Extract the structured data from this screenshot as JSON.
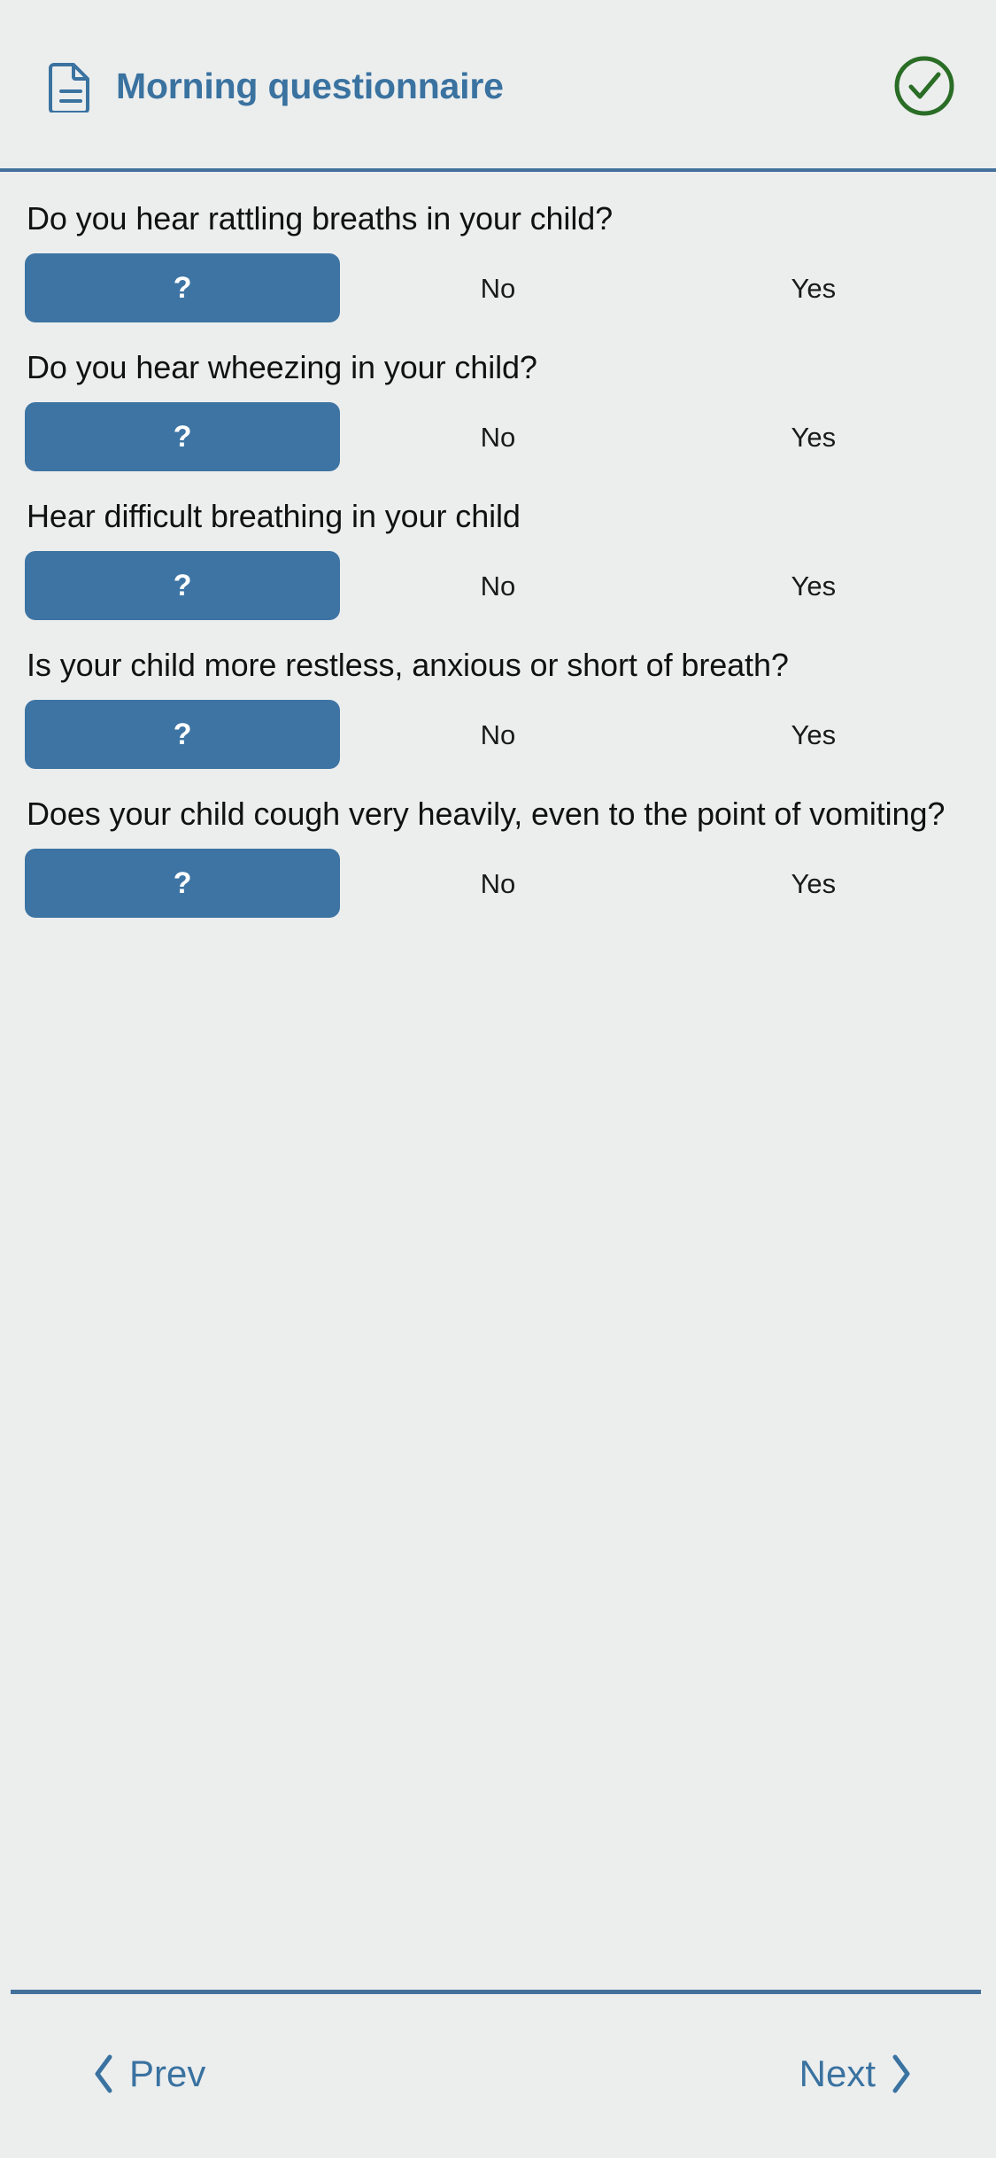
{
  "header": {
    "doc_icon": "document-icon",
    "title": "Morning questionnaire",
    "status_icon": "check-circle-icon",
    "accent_color": "#3a72a0",
    "status_color": "#2a6d26"
  },
  "questions": [
    {
      "text": "Do you hear rattling breaths in your child?",
      "options": [
        {
          "label": "?",
          "selected": true
        },
        {
          "label": "No",
          "selected": false
        },
        {
          "label": "Yes",
          "selected": false
        }
      ]
    },
    {
      "text": "Do you hear wheezing in your child?",
      "options": [
        {
          "label": "?",
          "selected": true
        },
        {
          "label": "No",
          "selected": false
        },
        {
          "label": "Yes",
          "selected": false
        }
      ]
    },
    {
      "text": "Hear difficult breathing in your child",
      "options": [
        {
          "label": "?",
          "selected": true
        },
        {
          "label": "No",
          "selected": false
        },
        {
          "label": "Yes",
          "selected": false
        }
      ]
    },
    {
      "text": "Is your child more restless, anxious or short of breath?",
      "options": [
        {
          "label": "?",
          "selected": true
        },
        {
          "label": "No",
          "selected": false
        },
        {
          "label": "Yes",
          "selected": false
        }
      ]
    },
    {
      "text": "Does your child cough very heavily, even to the point of vomiting?",
      "options": [
        {
          "label": "?",
          "selected": true
        },
        {
          "label": "No",
          "selected": false
        },
        {
          "label": "Yes",
          "selected": false
        }
      ]
    }
  ],
  "footer": {
    "prev_label": "Prev",
    "next_label": "Next",
    "prev_icon": "chevron-left-icon",
    "next_icon": "chevron-right-icon",
    "link_color": "#3a72a0"
  },
  "theme": {
    "background": "#eceeee",
    "selected_segment": "#3d74a3",
    "divider": "#44719c",
    "question_text": "#111111"
  }
}
